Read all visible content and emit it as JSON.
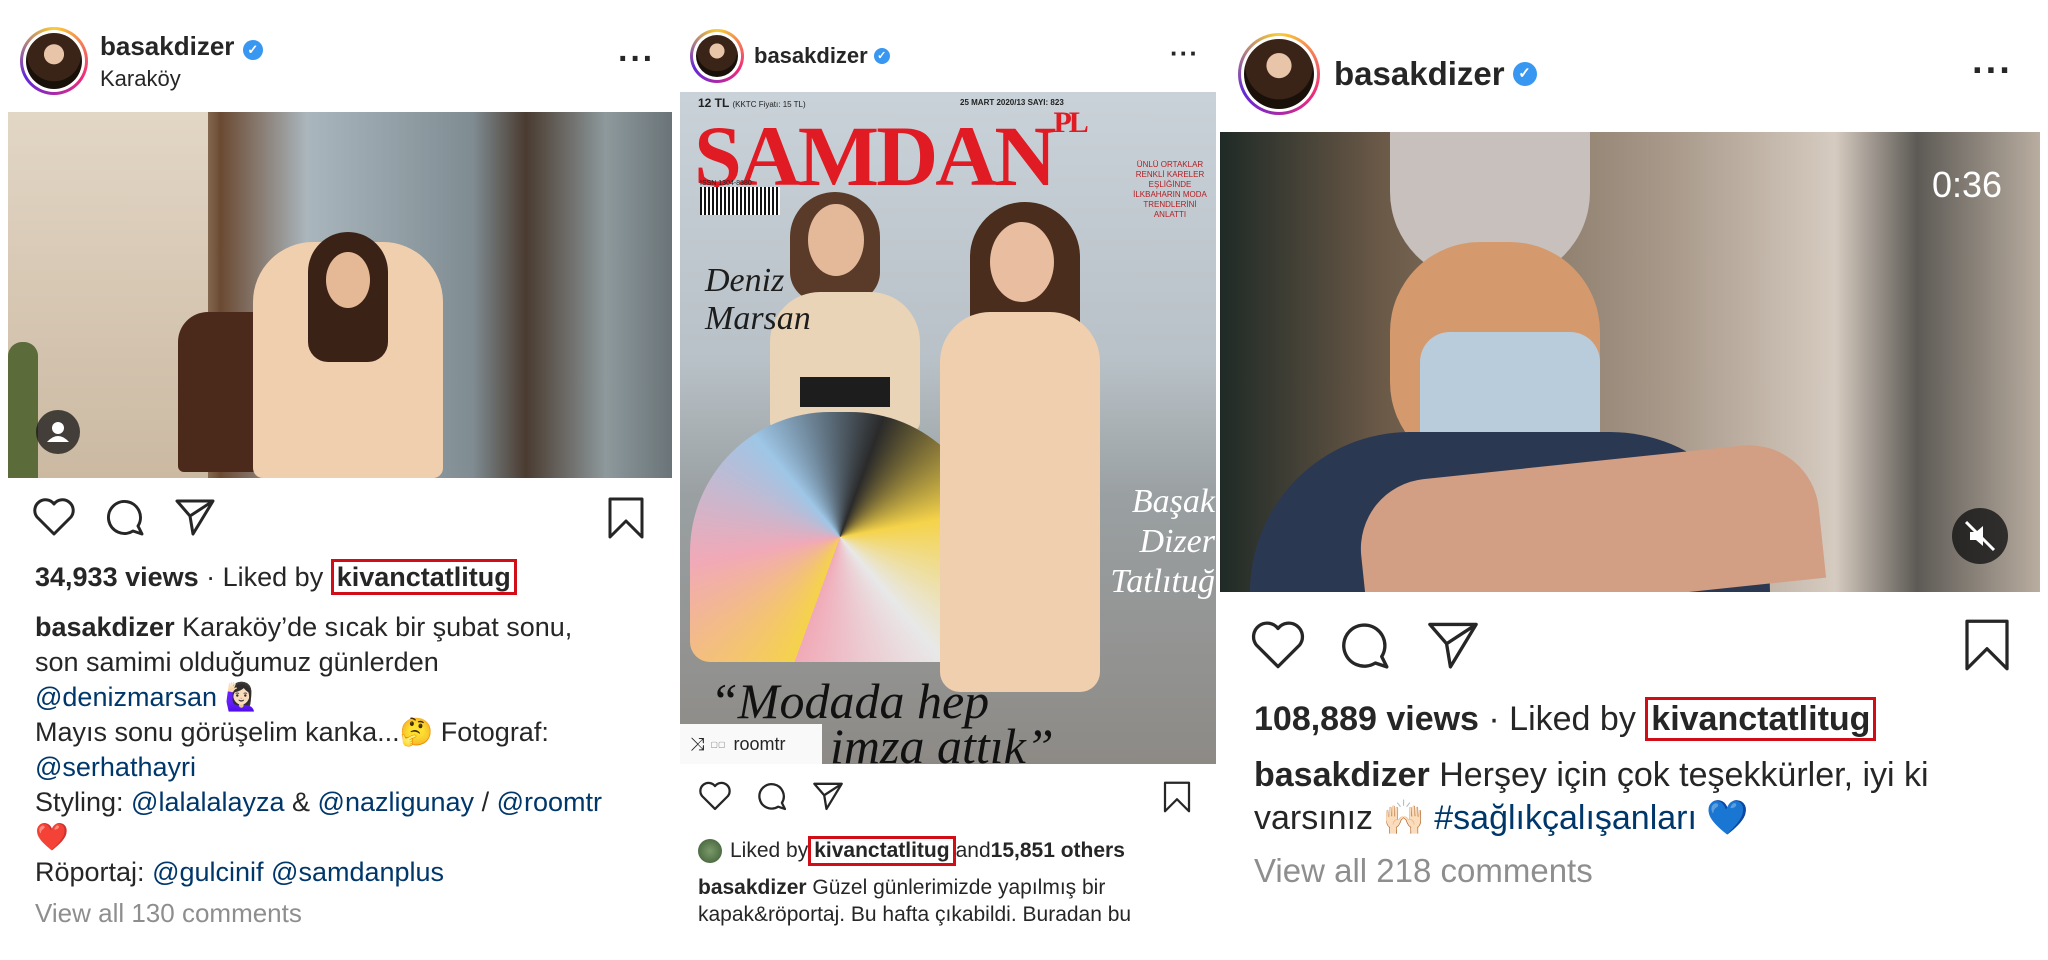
{
  "post1": {
    "username": "basakdizer",
    "location": "Karaköy",
    "stats_views": "34,933 views",
    "stats_liked_by": " · Liked by ",
    "liker": "kivanctatlitug",
    "caption_lines": [
      {
        "user": "basakdizer",
        "text": " Karaköy’de sıcak bir şubat sonu,"
      },
      {
        "text": "son samimi olduğumuz günlerden"
      },
      {
        "link": "@denizmarsan",
        "text": " 🙋🏻‍♀️"
      },
      {
        "text": "Mayıs sonu görüşelim kanka...🤔 Fotograf:"
      },
      {
        "link": "@serhathayri"
      },
      {
        "pre": "Styling: ",
        "link": "@lalalalayza",
        "mid": " & ",
        "link2": "@nazligunay",
        "mid2": " / ",
        "link3": "@roomtr"
      },
      {
        "text": "❤️"
      },
      {
        "pre": "Röportaj: ",
        "link": "@gulcinif",
        "mid": " ",
        "link2": "@samdanplus"
      }
    ],
    "view_comments": "View all 130 comments"
  },
  "post2": {
    "username": "basakdizer",
    "magazine": {
      "price": "12 TL",
      "price_note": "(KKTC Fiyatı: 15 TL)",
      "issue": "25 MART 2020/13 SAYI: 823",
      "brand": "ŞAMDAN",
      "brand_suffix": "PL",
      "issn": "ISSN 1304-8380",
      "side_text": "ÜNLÜ ORTAKLAR RENKLİ KARELER EŞLİĞİNDE İLKBAHARIN MODA TRENDLERİNİ ANLATTI",
      "name_left": "Deniz Marsan",
      "name_right": "Başak Dizer Tatlıtuğ",
      "quote_line1": "“Modada hep",
      "quote_line2": "imza attık”"
    },
    "tag": "roomtr",
    "liked_pre": "Liked by ",
    "liker": "kivanctatlitug",
    "liked_and": " and ",
    "liked_others": "15,851 others",
    "caption_user": "basakdizer",
    "caption_line1": " Güzel günlerimizde yapılmış bir",
    "caption_line2": "kapak&röportaj. Bu hafta çıkabildi. Buradan bu"
  },
  "post3": {
    "username": "basakdizer",
    "video_time": "0:36",
    "stats_views": "108,889 views",
    "stats_liked_by": " · Liked by ",
    "liker": "kivanctatlitug",
    "caption_user": "basakdizer",
    "caption_line1": " Herşey için çok teşekkürler, iyi ki",
    "caption_line2_text": "varsınız 🙌🏻 ",
    "caption_hashtag": "#sağlıkçalışanları",
    "caption_heart": " 💙",
    "view_comments": "View all 218 comments"
  },
  "colors": {
    "highlight_box": "#d10d17",
    "link": "#00376b",
    "verified": "#3897f0"
  },
  "icons": [
    "heart-icon",
    "comment-icon",
    "share-icon",
    "bookmark-icon",
    "more-icon",
    "verified-icon",
    "mute-icon",
    "user-tag-icon"
  ]
}
